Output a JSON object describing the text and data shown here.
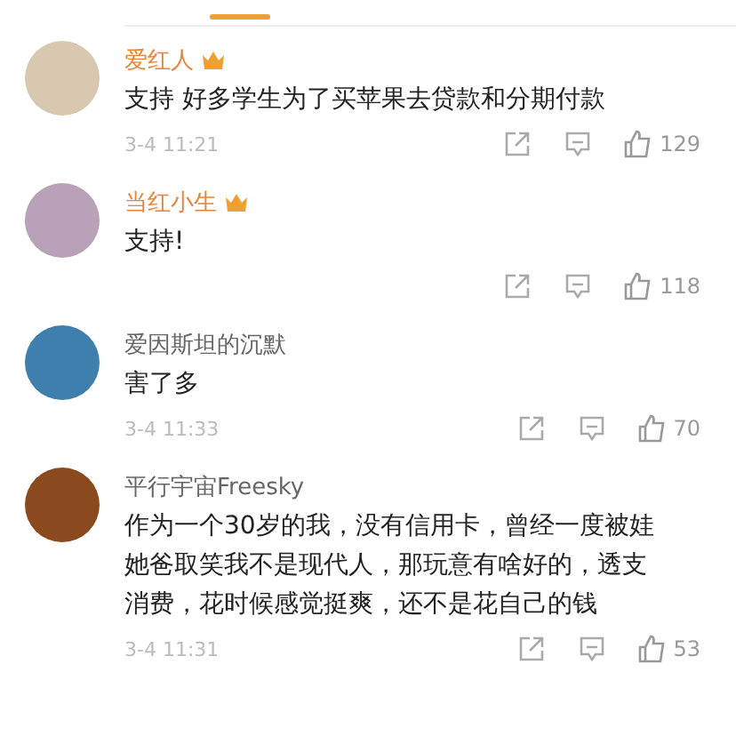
{
  "comments": [
    {
      "name": "爱红人",
      "vip": true,
      "text": "支持 好多学生为了买苹果去贷款和分期付款",
      "time": "3-4 11:21",
      "likes": "129"
    },
    {
      "name": "当红小生",
      "vip": true,
      "text": "支持!",
      "likes": "118"
    },
    {
      "name": "爱因斯坦的沉默",
      "vip": false,
      "text": "害了多",
      "time": "3-4 11:33",
      "likes": "70"
    },
    {
      "name": "平行宇宙Freesky",
      "vip": false,
      "text": "作为一个30岁的我，没有信用卡，曾经一度被娃她爸取笑我不是现代人，那玩意有啥好的，透支消费，花时候感觉挺爽，还不是花自己的钱",
      "time": "3-4 11:31",
      "likes": "53"
    }
  ]
}
